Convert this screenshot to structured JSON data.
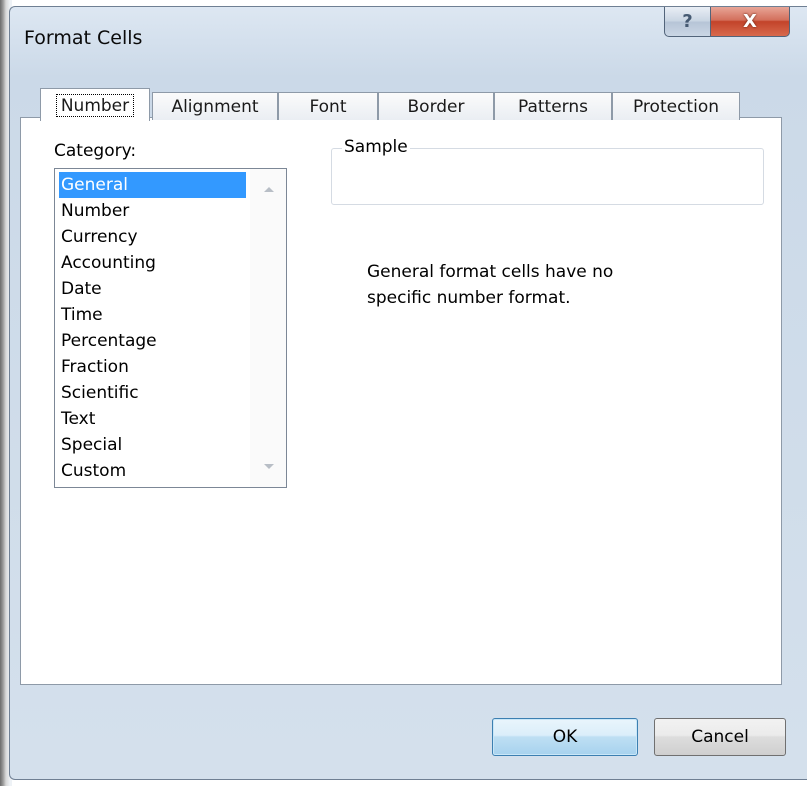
{
  "window": {
    "title": "Format Cells",
    "help_glyph": "?",
    "close_glyph": "X"
  },
  "tabs": [
    {
      "label": "Number",
      "active": true
    },
    {
      "label": "Alignment",
      "active": false
    },
    {
      "label": "Font",
      "active": false
    },
    {
      "label": "Border",
      "active": false
    },
    {
      "label": "Patterns",
      "active": false
    },
    {
      "label": "Protection",
      "active": false
    }
  ],
  "category": {
    "label": "Category:",
    "items": [
      "General",
      "Number",
      "Currency",
      "Accounting",
      "Date",
      "Time",
      "Percentage",
      "Fraction",
      "Scientific",
      "Text",
      "Special",
      "Custom"
    ],
    "selected": "General"
  },
  "sample": {
    "legend": "Sample",
    "value": ""
  },
  "description": "General format cells have no\nspecific number format.",
  "buttons": {
    "ok": "OK",
    "cancel": "Cancel"
  },
  "colors": {
    "selection": "#3399ff",
    "close_button": "#c2432a",
    "default_button_border": "#3c7fb1"
  }
}
